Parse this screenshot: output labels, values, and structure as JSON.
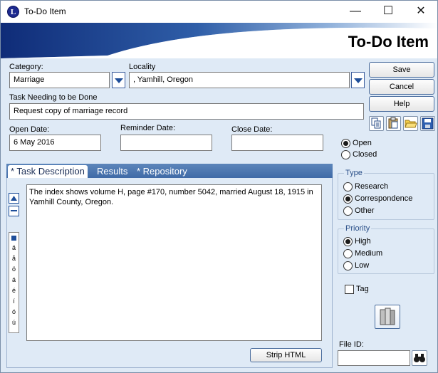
{
  "window": {
    "title": "To-Do Item",
    "minimize_glyph": "—",
    "maximize_glyph": "☐",
    "close_glyph": "✕"
  },
  "banner": {
    "title": "To-Do Item"
  },
  "form": {
    "category_label": "Category:",
    "category_value": "Marriage",
    "locality_label": "Locality",
    "locality_value": ", Yamhill, Oregon",
    "task_label": "Task Needing to be Done",
    "task_value": "Request copy of marriage record",
    "open_date_label": "Open Date:",
    "open_date_value": "6 May 2016",
    "reminder_date_label": "Reminder Date:",
    "reminder_date_value": "",
    "close_date_label": "Close Date:",
    "close_date_value": ""
  },
  "buttons": {
    "save": "Save",
    "cancel": "Cancel",
    "help": "Help",
    "strip_html": "Strip HTML"
  },
  "toolbar_icons": [
    "copy-icon",
    "paste-icon",
    "folder-icon",
    "save-disk-icon"
  ],
  "status": {
    "options": [
      "Open",
      "Closed"
    ],
    "selected": "Open"
  },
  "type_group": {
    "title": "Type",
    "options": [
      "Research",
      "Correspondence",
      "Other"
    ],
    "selected": "Correspondence"
  },
  "priority_group": {
    "title": "Priority",
    "options": [
      "High",
      "Medium",
      "Low"
    ],
    "selected": "High"
  },
  "tag": {
    "label": "Tag",
    "checked": false
  },
  "file_id": {
    "label": "File ID:",
    "value": ""
  },
  "tabs": [
    "* Task Description",
    "Results",
    "* Repository"
  ],
  "active_tab": "* Task Description",
  "description_text": "The index shows volume H, page #170, number 5042, married August 18, 1915 in Yamhill County, Oregon.",
  "special_chars": [
    "ä",
    "å",
    "ö",
    "á",
    "é",
    "í",
    "ó",
    "ú"
  ],
  "colors": {
    "accent": "#1f4f9a",
    "tab_bar": "#4a74ad",
    "window_bg": "#dfeaf6"
  }
}
